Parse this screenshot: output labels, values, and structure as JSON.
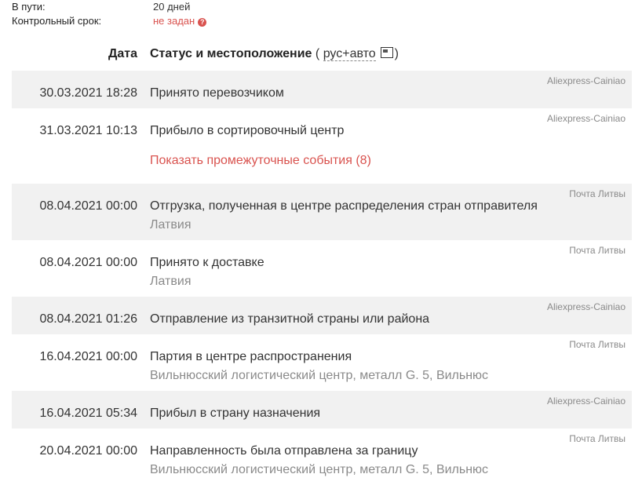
{
  "summary": {
    "in_transit_label": "В пути:",
    "in_transit_value": "20 дней",
    "deadline_label": "Контрольный срок:",
    "deadline_value": "не задан",
    "help_glyph": "?"
  },
  "table_header": {
    "date": "Дата",
    "status": "Статус и местоположение",
    "open_paren": "(",
    "translate_toggle": "рус+авто",
    "close_paren": ")"
  },
  "show_more_label": "Показать промежуточные события (8)",
  "colors": {
    "accent": "#d9534f",
    "shaded_row": "#f1f1f1",
    "muted_text": "#8a8a8a"
  },
  "events": [
    {
      "date": "30.03.2021 18:28",
      "status": "Принято перевозчиком",
      "location": "",
      "carrier": "Aliexpress-Cainiao"
    },
    {
      "date": "31.03.2021 10:13",
      "status": "Прибыло в сортировочный центр",
      "location": "",
      "carrier": "Aliexpress-Cainiao"
    },
    {
      "date": "08.04.2021 00:00",
      "status": "Отгрузка, полученная в центре распределения стран отправителя",
      "location": "Латвия",
      "carrier": "Почта Литвы"
    },
    {
      "date": "08.04.2021 00:00",
      "status": "Принято к доставке",
      "location": "Латвия",
      "carrier": "Почта Литвы"
    },
    {
      "date": "08.04.2021 01:26",
      "status": "Отправление из транзитной страны или района",
      "location": "",
      "carrier": "Aliexpress-Cainiao"
    },
    {
      "date": "16.04.2021 00:00",
      "status": "Партия в центре распространения",
      "location": "Вильнюсский логистический центр, металл G. 5, Вильнюс",
      "carrier": "Почта Литвы"
    },
    {
      "date": "16.04.2021 05:34",
      "status": "Прибыл в страну назначения",
      "location": "",
      "carrier": "Aliexpress-Cainiao"
    },
    {
      "date": "20.04.2021 00:00",
      "status": "Направленность была отправлена за границу",
      "location": "Вильнюсский логистический центр, металл G. 5, Вильнюс",
      "carrier": "Почта Литвы"
    }
  ]
}
